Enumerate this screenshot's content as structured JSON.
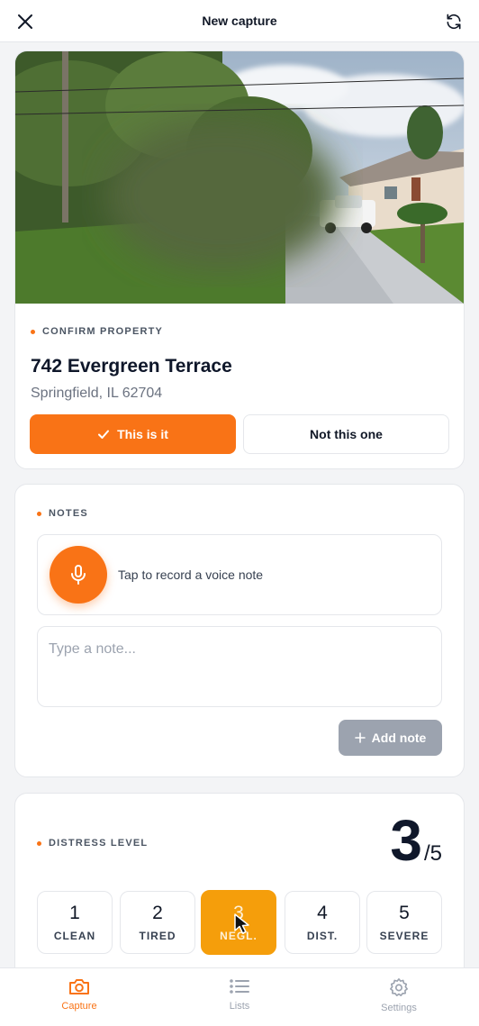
{
  "header": {
    "title": "New capture",
    "close_icon": "close-icon",
    "refresh_icon": "refresh-icon"
  },
  "property": {
    "section_label": "CONFIRM PROPERTY",
    "address": "742 Evergreen Terrace",
    "city": "Springfield, IL 62704",
    "confirm_label": "This is it",
    "reject_label": "Not this one",
    "accent": "#f97316"
  },
  "notes": {
    "section_label": "NOTES",
    "voice_prompt": "Tap to record a voice note",
    "placeholder": "Type a note...",
    "add_label": "Add note"
  },
  "distress": {
    "section_label": "DISTRESS LEVEL",
    "score": "3",
    "max": "/5",
    "levels": [
      {
        "num": "1",
        "label": "CLEAN"
      },
      {
        "num": "2",
        "label": "TIRED"
      },
      {
        "num": "3",
        "label": "NEGL."
      },
      {
        "num": "4",
        "label": "DIST."
      },
      {
        "num": "5",
        "label": "SEVERE"
      }
    ],
    "selected_index": 2,
    "selected_color": "#f59e0b"
  },
  "nav": {
    "items": [
      {
        "label": "Capture",
        "icon": "camera-icon",
        "active": true
      },
      {
        "label": "Lists",
        "icon": "list-icon",
        "active": false
      },
      {
        "label": "Settings",
        "icon": "gear-icon",
        "active": false
      }
    ]
  }
}
